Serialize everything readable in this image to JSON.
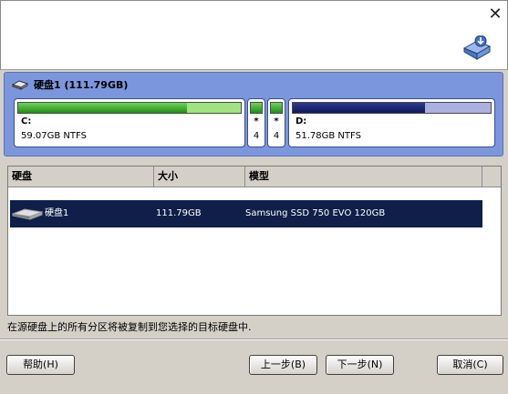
{
  "window": {
    "close_glyph": "✕",
    "icon": "disk-copy-icon"
  },
  "disk": {
    "title": "硬盘1 (111.79GB)",
    "icon": "hard-disk-icon",
    "partitions": [
      {
        "label": "C:",
        "info": "59.07GB NTFS",
        "used_fraction": 0.76,
        "color": "#1f8f14"
      },
      {
        "label": "*",
        "info": "4",
        "used_fraction": 1.0,
        "color": "#1f8f14"
      },
      {
        "label": "*",
        "info": "4",
        "used_fraction": 1.0,
        "color": "#1f8f14"
      },
      {
        "label": "D:",
        "info": "51.78GB NTFS",
        "used_fraction": 0.67,
        "color": "#0f1860"
      }
    ]
  },
  "table": {
    "columns": [
      "硬盘",
      "大小",
      "模型"
    ],
    "rows": [
      {
        "name": "硬盘1",
        "size": "111.79GB",
        "model": "Samsung SSD 750 EVO 120GB",
        "icon": "hard-disk-icon"
      }
    ]
  },
  "status_text": "在源硬盘上的所有分区将被复制到您选择的目标硬盘中.",
  "buttons": {
    "help": "帮助(H)",
    "back": "上一步(B)",
    "next": "下一步(N)",
    "cancel": "取消(C)"
  },
  "colors": {
    "panel": "#7b96dc",
    "selected_row": "#0f1f4a",
    "green": "#1f8f14",
    "navy": "#0f1860"
  }
}
